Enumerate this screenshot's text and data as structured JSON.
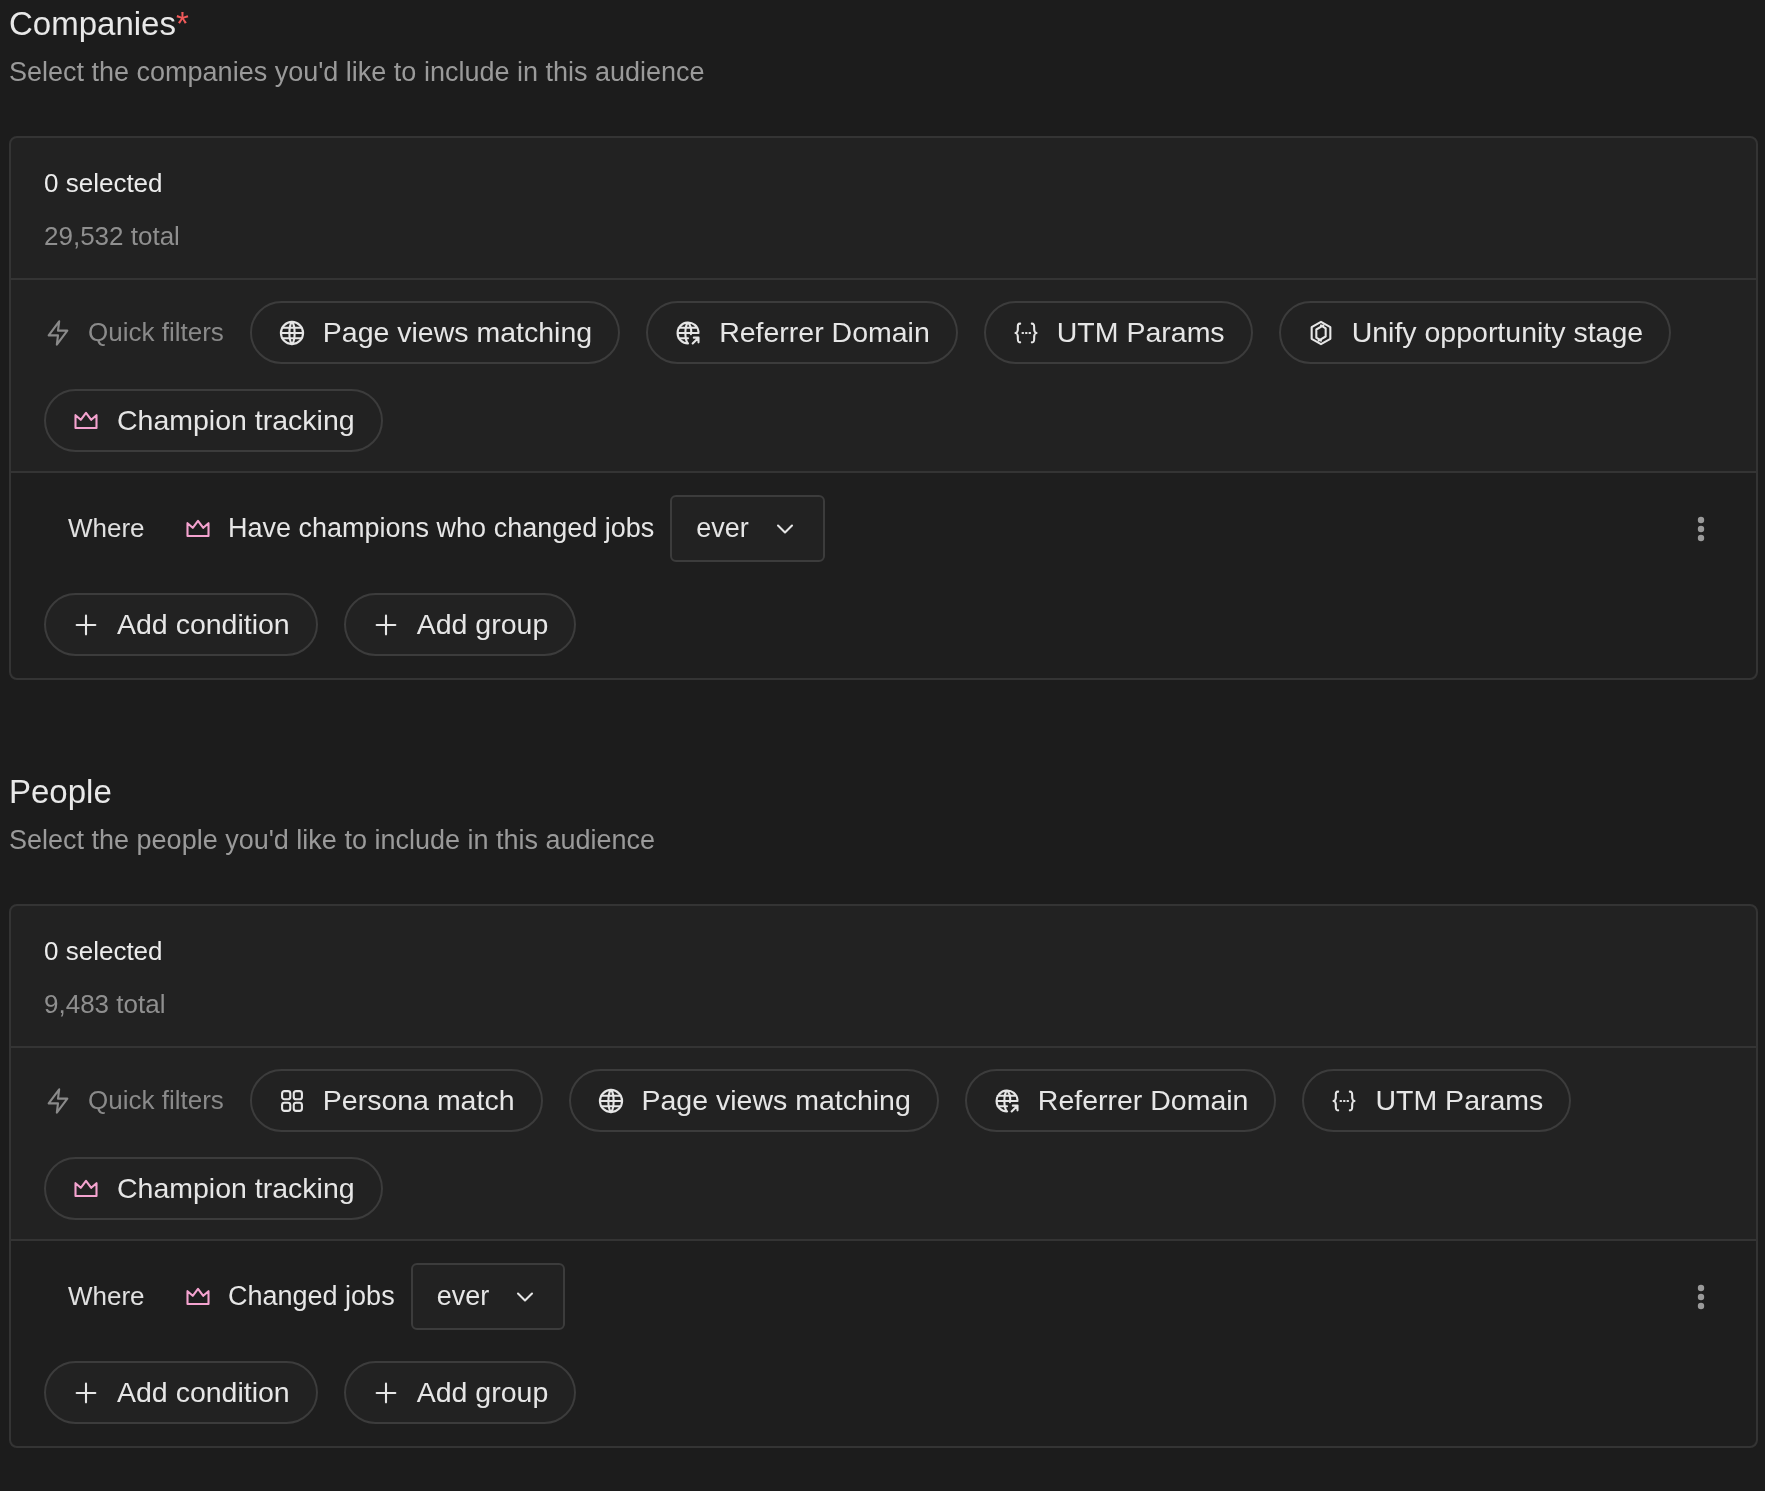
{
  "sections": [
    {
      "title": "Companies",
      "required_mark": "*",
      "subtitle": "Select the companies you'd like to include in this audience",
      "selected_count": "0 selected",
      "total": "29,532 total",
      "quick_filters_label": "Quick filters",
      "quick_filters": [
        {
          "label": "Page views matching",
          "kind": "globe"
        },
        {
          "label": "Referrer Domain",
          "kind": "globe-arrow"
        },
        {
          "label": "UTM Params",
          "kind": "braces"
        },
        {
          "label": "Unify opportunity stage",
          "kind": "logo"
        },
        {
          "label": "Champion tracking",
          "kind": "crown"
        }
      ],
      "condition": {
        "where": "Where",
        "kind": "crown",
        "field": "Have champions who changed jobs",
        "operator": "ever"
      },
      "actions": [
        "Add condition",
        "Add group"
      ]
    },
    {
      "title": "People",
      "subtitle": "Select the people you'd like to include in this audience",
      "selected_count": "0 selected",
      "total": "9,483 total",
      "quick_filters_label": "Quick filters",
      "quick_filters": [
        {
          "label": "Persona match",
          "kind": "grid"
        },
        {
          "label": "Page views matching",
          "kind": "globe"
        },
        {
          "label": "Referrer Domain",
          "kind": "globe-arrow"
        },
        {
          "label": "UTM Params",
          "kind": "braces"
        },
        {
          "label": "Champion tracking",
          "kind": "crown"
        }
      ],
      "condition": {
        "where": "Where",
        "kind": "crown",
        "field": "Changed jobs",
        "operator": "ever"
      },
      "actions": [
        "Add condition",
        "Add group"
      ]
    }
  ]
}
